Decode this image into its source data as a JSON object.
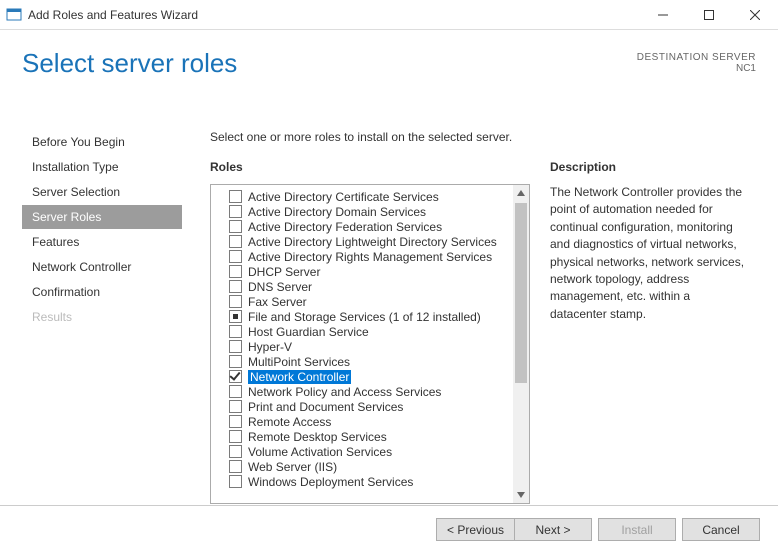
{
  "window": {
    "title": "Add Roles and Features Wizard"
  },
  "page": {
    "title": "Select server roles",
    "destination_label": "DESTINATION SERVER",
    "destination_value": "NC1",
    "instruction": "Select one or more roles to install on the selected server."
  },
  "sidebar": {
    "items": [
      {
        "label": "Before You Begin"
      },
      {
        "label": "Installation Type"
      },
      {
        "label": "Server Selection"
      },
      {
        "label": "Server Roles"
      },
      {
        "label": "Features"
      },
      {
        "label": "Network Controller"
      },
      {
        "label": "Confirmation"
      },
      {
        "label": "Results"
      }
    ]
  },
  "roles": {
    "heading": "Roles",
    "items": [
      {
        "label": "Active Directory Certificate Services",
        "checked": false
      },
      {
        "label": "Active Directory Domain Services",
        "checked": false
      },
      {
        "label": "Active Directory Federation Services",
        "checked": false
      },
      {
        "label": "Active Directory Lightweight Directory Services",
        "checked": false
      },
      {
        "label": "Active Directory Rights Management Services",
        "checked": false
      },
      {
        "label": "DHCP Server",
        "checked": false
      },
      {
        "label": "DNS Server",
        "checked": false
      },
      {
        "label": "Fax Server",
        "checked": false
      },
      {
        "label": "File and Storage Services (1 of 12 installed)",
        "checked": false,
        "partial": true,
        "expandable": true
      },
      {
        "label": "Host Guardian Service",
        "checked": false
      },
      {
        "label": "Hyper-V",
        "checked": false
      },
      {
        "label": "MultiPoint Services",
        "checked": false
      },
      {
        "label": "Network Controller",
        "checked": true,
        "selected": true
      },
      {
        "label": "Network Policy and Access Services",
        "checked": false
      },
      {
        "label": "Print and Document Services",
        "checked": false
      },
      {
        "label": "Remote Access",
        "checked": false
      },
      {
        "label": "Remote Desktop Services",
        "checked": false
      },
      {
        "label": "Volume Activation Services",
        "checked": false
      },
      {
        "label": "Web Server (IIS)",
        "checked": false
      },
      {
        "label": "Windows Deployment Services",
        "checked": false
      }
    ]
  },
  "description": {
    "heading": "Description",
    "text": "The Network Controller provides the point of automation needed for continual configuration, monitoring and diagnostics of virtual networks, physical networks, network services, network topology, address management, etc. within a datacenter stamp."
  },
  "footer": {
    "previous": "< Previous",
    "next": "Next >",
    "install": "Install",
    "cancel": "Cancel"
  }
}
